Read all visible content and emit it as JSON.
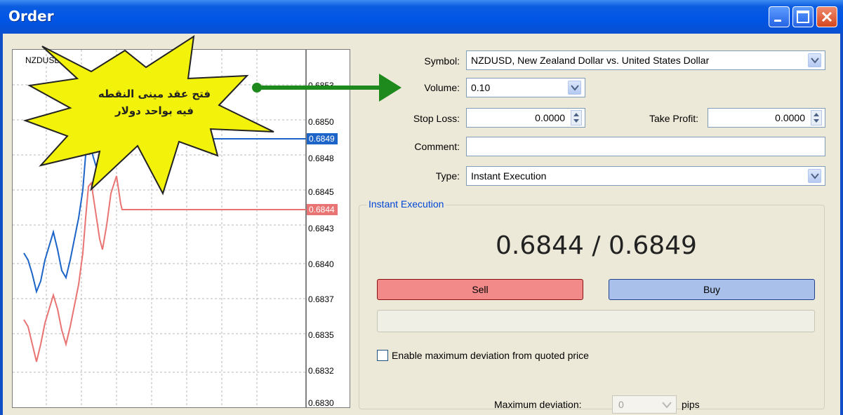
{
  "window": {
    "title": "Order"
  },
  "chart": {
    "symbol": "NZDUSD",
    "ticks": [
      "0.6853",
      "0.6850",
      "0.6848",
      "0.6845",
      "0.6843",
      "0.6840",
      "0.6837",
      "0.6835",
      "0.6832",
      "0.6830"
    ],
    "ask_tag": "0.6849",
    "bid_tag": "0.6844",
    "ask_color": "#1c64c8",
    "bid_color": "#e87474"
  },
  "callout": {
    "line1": "فتح عقد مينى النقطه",
    "line2": "فيه بواحد دولار",
    "color": "#f3f20a"
  },
  "form": {
    "symbol_label": "Symbol:",
    "symbol_value": "NZDUSD, New Zealand Dollar vs. United States Dollar",
    "volume_label": "Volume:",
    "volume_value": "0.10",
    "stoploss_label": "Stop Loss:",
    "stoploss_value": "0.0000",
    "takeprofit_label": "Take Profit:",
    "takeprofit_value": "0.0000",
    "comment_label": "Comment:",
    "comment_value": "",
    "type_label": "Type:",
    "type_value": "Instant Execution"
  },
  "execution": {
    "group_title": "Instant Execution",
    "quote": "0.6844 / 0.6849",
    "sell_label": "Sell",
    "buy_label": "Buy",
    "max_dev_checkbox_label": "Enable maximum deviation from quoted price",
    "max_dev_label": "Maximum deviation:",
    "max_dev_value": "0",
    "max_dev_unit": "pips"
  }
}
